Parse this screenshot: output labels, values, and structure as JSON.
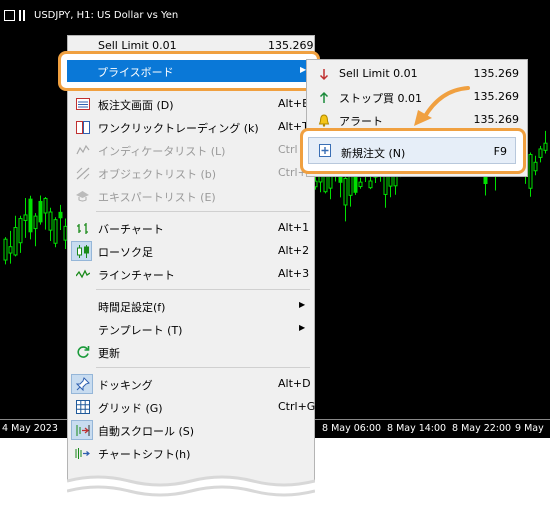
{
  "window": {
    "title": "USDJPY, H1:  US Dollar vs Yen"
  },
  "time_axis": [
    "4 May 2023",
    "8 May 06:00",
    "8 May 14:00",
    "8 May 22:00",
    "9 May"
  ],
  "context_menu": {
    "hidden_top_item": {
      "label": "Sell Limit 0.01",
      "price": "135.269"
    },
    "highlighted": {
      "label": "プライスボード"
    },
    "items": [
      {
        "label": "板注文画面 (D)",
        "shortcut": "Alt+B"
      },
      {
        "label": "ワンクリックトレーディング (k)",
        "shortcut": "Alt+T"
      },
      {
        "label": "インディケータリスト (L)",
        "shortcut": "Ctrl"
      },
      {
        "label": "オブジェクトリスト (b)",
        "shortcut": "Ctrl+B"
      },
      {
        "label": "エキスパートリスト (E)",
        "shortcut": ""
      },
      {
        "label": "バーチャート",
        "shortcut": "Alt+1"
      },
      {
        "label": "ローソク足",
        "shortcut": "Alt+2"
      },
      {
        "label": "ラインチャート",
        "shortcut": "Alt+3"
      },
      {
        "label": "時間足設定(f)",
        "shortcut": ""
      },
      {
        "label": "テンプレート (T)",
        "shortcut": ""
      },
      {
        "label": "更新",
        "shortcut": ""
      },
      {
        "label": "ドッキング",
        "shortcut": "Alt+D"
      },
      {
        "label": "グリッド (G)",
        "shortcut": "Ctrl+G"
      },
      {
        "label": "自動スクロール (S)",
        "shortcut": ""
      },
      {
        "label": "チャートシフト(h)",
        "shortcut": ""
      }
    ]
  },
  "submenu": {
    "items": [
      {
        "label": "Sell Limit 0.01",
        "price": "135.269"
      },
      {
        "label": "ストップ買 0.01",
        "price": "135.269"
      },
      {
        "label": "アラート",
        "price": "135.269"
      }
    ],
    "new_order": {
      "label": "新規注文 (N)",
      "shortcut": "F9"
    }
  },
  "colors": {
    "highlight": "#0a78d7",
    "callout": "#f0a040",
    "candle": "#00e000"
  }
}
